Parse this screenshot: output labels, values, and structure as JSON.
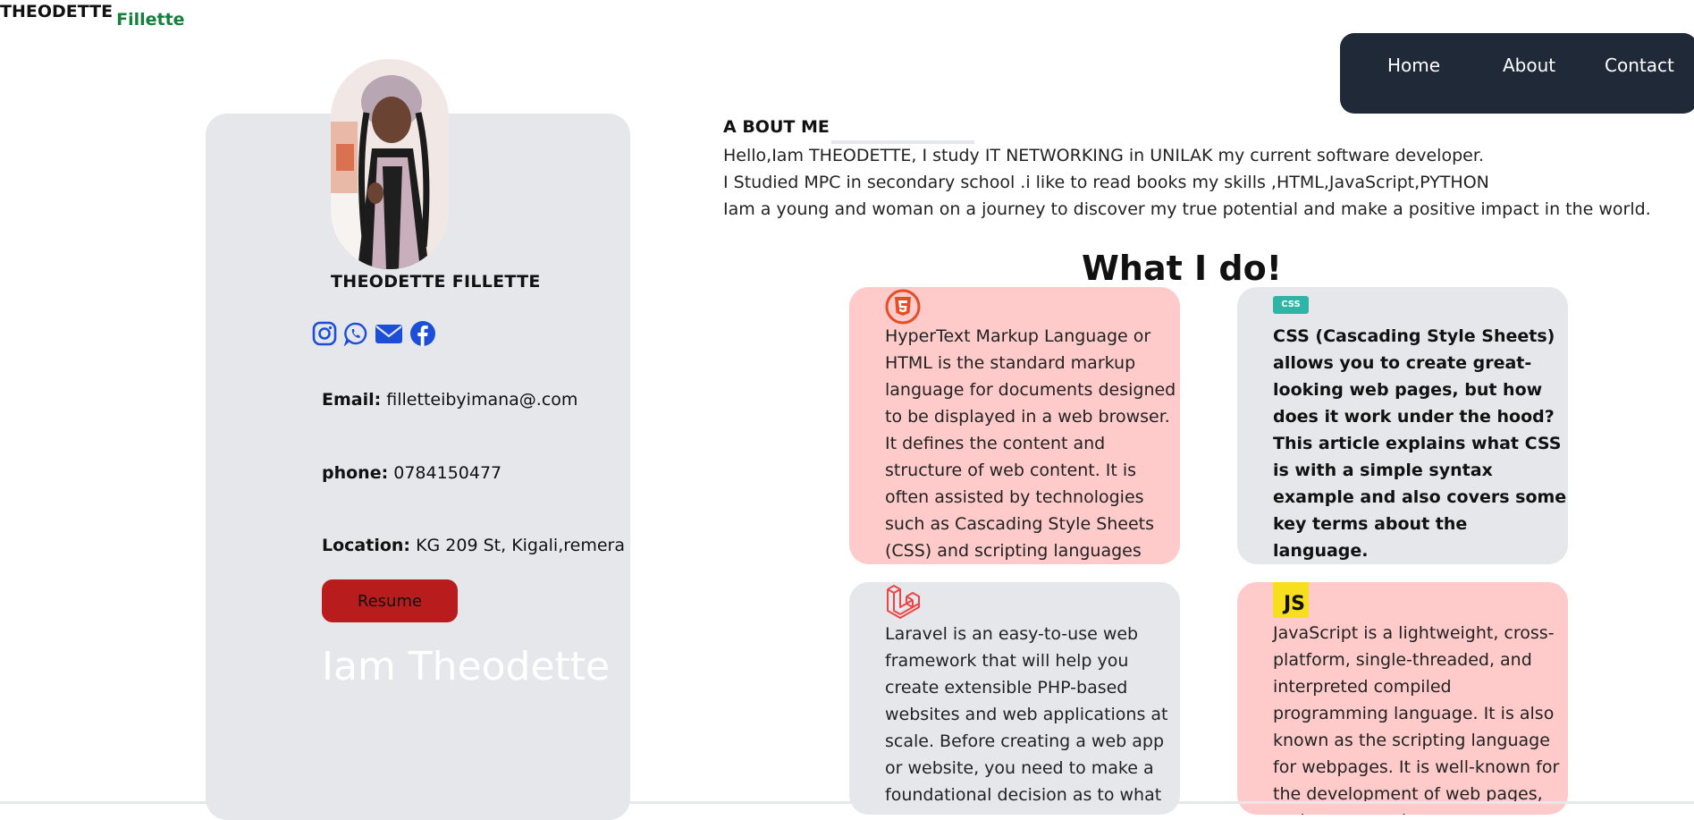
{
  "brand": {
    "first": "THEODETTE",
    "last": "Fillette"
  },
  "nav": {
    "home": "Home",
    "about": "About",
    "contact": "Contact"
  },
  "profile": {
    "name": "THEODETTE FILLETTE",
    "socials": [
      "instagram-icon",
      "whatsapp-icon",
      "email-icon",
      "facebook-icon"
    ],
    "email_label": "Email:",
    "email_value": "filletteibyimana@.com",
    "phone_label": "phone:",
    "phone_value": "0784150477",
    "location_label": "Location:",
    "location_value": "KG 209 St, Kigali,remera",
    "resume_label": "Resume",
    "tagline": "Iam Theodette"
  },
  "about": {
    "title": "A BOUT ME",
    "lines": [
      "Hello,Iam THEODETTE, I study IT NETWORKING in UNILAK my current software developer.",
      "I Studied MPC in secondary school .i like to read books my skills ,HTML,JavaScript,PYTHON",
      "Iam a young and woman on a journey to discover my true potential and make a positive impact in the world."
    ]
  },
  "services": {
    "title": "What I do!",
    "items": [
      {
        "icon": "html5-icon",
        "text": "HyperText Markup Language or HTML is the standard markup language for documents designed to be displayed in a web browser. It defines the content and structure of web content. It is often assisted by technologies such as Cascading Style Sheets (CSS) and scripting languages such as JavaScript."
      },
      {
        "icon": "css-icon",
        "icon_text": "CSS",
        "text": "CSS (Cascading Style Sheets) allows you to create great-looking web pages, but how does it work under the hood? This article explains what CSS is with a simple syntax example and also covers some key terms about the language."
      },
      {
        "icon": "laravel-icon",
        "text": "Laravel is an easy-to-use web framework that will help you create extensible PHP-based websites and web applications at scale. Before creating a web app or website, you need to make a foundational decision as to what technology you"
      },
      {
        "icon": "js-icon",
        "icon_text": "JS",
        "text": "JavaScript is a lightweight, cross-platform, single-threaded, and interpreted compiled programming language. It is also known as the scripting language for webpages. It is well-known for the development of web pages, and many non-browser"
      }
    ]
  },
  "colors": {
    "nav_bg": "#1f2937",
    "card_bg": "#e5e7eb",
    "pink_card": "#fecaca",
    "resume_btn": "#b91c1c",
    "brand_accent": "#15803d",
    "social_icons": "#1d4ed8",
    "html_icon": "#e44d26",
    "css_badge": "#2fb4a5",
    "js_badge": "#f7df1e",
    "laravel_icon": "#ef4444"
  }
}
